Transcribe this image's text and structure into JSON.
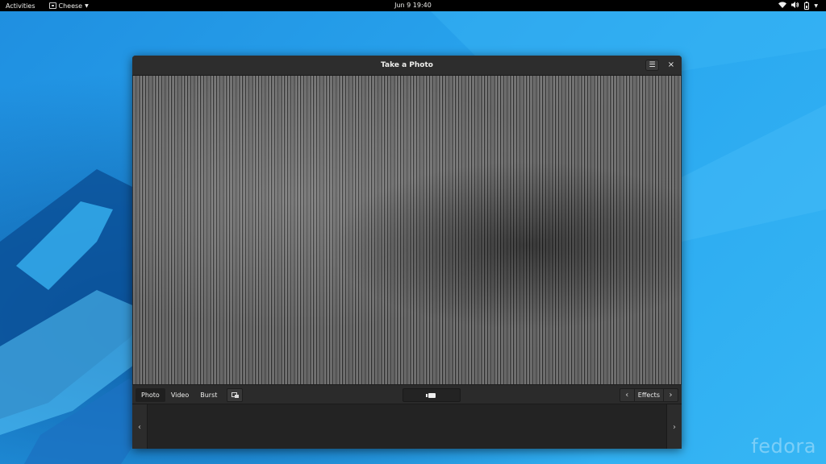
{
  "topbar": {
    "activities": "Activities",
    "app_name": "Cheese",
    "clock": "Jun 9  19:40",
    "tray_icons": [
      "wifi-icon",
      "volume-icon",
      "battery-icon",
      "menu-caret-icon"
    ]
  },
  "desktop": {
    "watermark": "fedora"
  },
  "window": {
    "title": "Take a Photo",
    "menu_icon": "☰",
    "close_icon": "×"
  },
  "toolbar": {
    "modes": [
      "Photo",
      "Video",
      "Burst"
    ],
    "active_mode": "Photo",
    "effects_label": "Effects",
    "prev_arrow": "‹",
    "next_arrow": "›"
  },
  "thumbnails": {
    "prev_arrow": "‹",
    "next_arrow": "›"
  },
  "colors": {
    "topbar": "#000000",
    "window": "#2b2b2b",
    "wallpaper": "#29a3e8"
  }
}
